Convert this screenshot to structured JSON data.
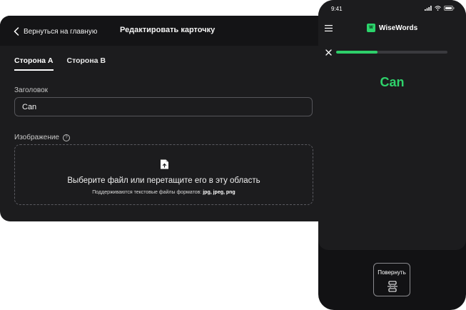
{
  "editor": {
    "back_label": "Вернуться на главную",
    "title": "Редактировать карточку",
    "tabs": [
      {
        "label": "Сторона А",
        "active": true
      },
      {
        "label": "Сторона В",
        "active": false
      }
    ],
    "title_field": {
      "label": "Заголовок",
      "value": "Can"
    },
    "image_field": {
      "label": "Изображение",
      "help_glyph": "?"
    },
    "dropzone": {
      "main_text": "Выберите файл или перетащите его в эту область",
      "hint_prefix": "Поддерживаются текстовые файлы форматов:",
      "hint_formats": "jpg, jpeg, png"
    }
  },
  "phone": {
    "status_time": "9:41",
    "app_name": "WiseWords",
    "logo_letter": "W",
    "progress_percent": 37,
    "card_word": "Can",
    "flip_label": "Повернуть"
  },
  "colors": {
    "accent": "#2ed26b",
    "panel_bg": "#1c1c1e",
    "header_bg": "#141416"
  },
  "icons": {
    "back": "chevron-left-icon",
    "help": "question-circle-icon",
    "upload": "file-upload-icon",
    "menu": "hamburger-icon",
    "close": "close-icon",
    "flip": "flip-card-icon"
  }
}
